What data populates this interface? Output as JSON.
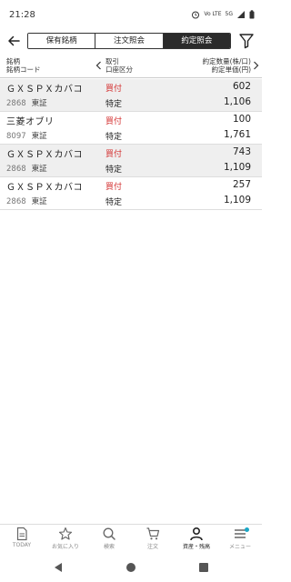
{
  "status_bar": {
    "time": "21:28",
    "network": "Vo LTE",
    "signal": "5G"
  },
  "tabs": {
    "items": [
      {
        "label": "保有銘柄",
        "active": false
      },
      {
        "label": "注文照会",
        "active": false
      },
      {
        "label": "約定照会",
        "active": true
      }
    ]
  },
  "columns": {
    "stock": "銘柄",
    "stock_code": "銘柄コード",
    "trade": "取引",
    "account_type": "口座区分",
    "exec_qty": "約定数量(株/口)",
    "exec_price": "約定単価(円)"
  },
  "executions": [
    {
      "name": "ＧＸＳＰＸカバコ",
      "code": "2868",
      "exchange": "東証",
      "side": "買付",
      "account": "特定",
      "quantity": "602",
      "price": "1,106"
    },
    {
      "name": "三菱オブリ",
      "code": "8097",
      "exchange": "東証",
      "side": "買付",
      "account": "特定",
      "quantity": "100",
      "price": "1,761"
    },
    {
      "name": "ＧＸＳＰＸカバコ",
      "code": "2868",
      "exchange": "東証",
      "side": "買付",
      "account": "特定",
      "quantity": "743",
      "price": "1,109"
    },
    {
      "name": "ＧＸＳＰＸカバコ",
      "code": "2868",
      "exchange": "東証",
      "side": "買付",
      "account": "特定",
      "quantity": "257",
      "price": "1,109"
    }
  ],
  "bottom_nav": [
    {
      "label": "TODAY",
      "icon": "today-icon"
    },
    {
      "label": "お気に入り",
      "icon": "star-icon"
    },
    {
      "label": "検索",
      "icon": "search-icon"
    },
    {
      "label": "注文",
      "icon": "cart-icon"
    },
    {
      "label": "資産・残高",
      "icon": "person-icon",
      "active": true
    },
    {
      "label": "メニュー",
      "icon": "menu-icon"
    }
  ],
  "colors": {
    "buy": "#d32f2f",
    "active_tab": "#2b2b2b",
    "menu_badge": "#1aa7c6"
  }
}
